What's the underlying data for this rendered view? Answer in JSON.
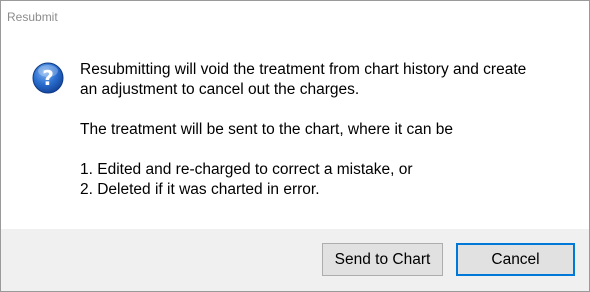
{
  "window": {
    "title": "Resubmit"
  },
  "dialog": {
    "icon": "question-icon",
    "message": {
      "line1": "Resubmitting will void the treatment from chart history and create",
      "line2": "an adjustment to cancel out the charges.",
      "line3": "The treatment will be sent to the chart, where it can be",
      "line4": "1. Edited and re-charged to correct a mistake, or",
      "line5": "2. Deleted if it was charted in error."
    }
  },
  "buttons": {
    "send_label": "Send to Chart",
    "cancel_label": "Cancel"
  },
  "colors": {
    "icon_blue": "#1f5fbf",
    "focus_border": "#0078d7",
    "footer_bg": "#f0f0f0"
  }
}
